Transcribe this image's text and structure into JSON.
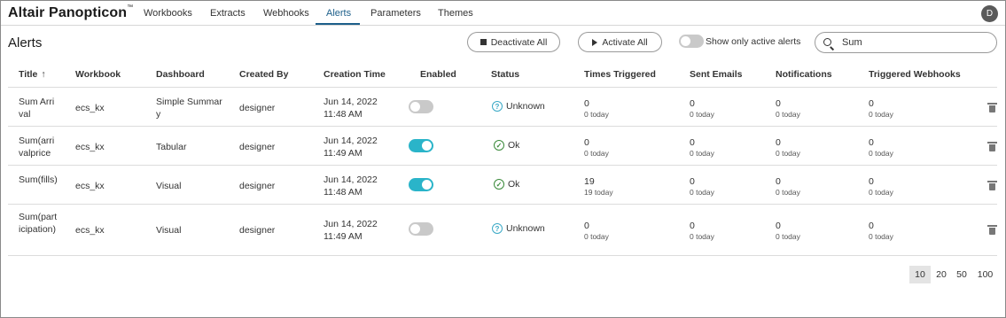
{
  "app": {
    "title": "Altair Panopticon",
    "trademark": "™",
    "user_initial": "D"
  },
  "nav": {
    "tabs": [
      {
        "label": "Workbooks"
      },
      {
        "label": "Extracts"
      },
      {
        "label": "Webhooks"
      },
      {
        "label": "Alerts"
      },
      {
        "label": "Parameters"
      },
      {
        "label": "Themes"
      }
    ],
    "active": "Alerts"
  },
  "page": {
    "title": "Alerts"
  },
  "toolbar": {
    "deactivate_label": "Deactivate All",
    "activate_label": "Activate All",
    "active_filter_label": "Show only active alerts",
    "active_filter_on": false,
    "search_value": "Sum"
  },
  "table": {
    "headers": {
      "title": "Title",
      "sort_indicator": "↑",
      "workbook": "Workbook",
      "dashboard": "Dashboard",
      "created_by": "Created By",
      "creation_time": "Creation Time",
      "enabled": "Enabled",
      "status": "Status",
      "times_triggered": "Times Triggered",
      "sent_emails": "Sent Emails",
      "notifications": "Notifications",
      "triggered_webhooks": "Triggered Webhooks"
    },
    "rows": [
      {
        "title": "Sum Arrival",
        "workbook": "ecs_kx",
        "dashboard": "Simple Summary",
        "created_by": "designer",
        "creation_time": "Jun 14, 2022 11:48 AM",
        "enabled": false,
        "status": "Unknown",
        "status_icon": "question-icon",
        "times_triggered": "0",
        "times_triggered_today": "0 today",
        "sent_emails": "0",
        "sent_emails_today": "0 today",
        "notifications": "0",
        "notifications_today": "0 today",
        "webhooks": "0",
        "webhooks_today": "0 today"
      },
      {
        "title": "Sum(arrivalprice",
        "workbook": "ecs_kx",
        "dashboard": "Tabular",
        "created_by": "designer",
        "creation_time": "Jun 14, 2022 11:49 AM",
        "enabled": true,
        "status": "Ok",
        "status_icon": "check-circle-icon",
        "times_triggered": "0",
        "times_triggered_today": "0 today",
        "sent_emails": "0",
        "sent_emails_today": "0 today",
        "notifications": "0",
        "notifications_today": "0 today",
        "webhooks": "0",
        "webhooks_today": "0 today"
      },
      {
        "title": "Sum(fills)",
        "workbook": "ecs_kx",
        "dashboard": "Visual",
        "created_by": "designer",
        "creation_time": "Jun 14, 2022 11:48 AM",
        "enabled": true,
        "status": "Ok",
        "status_icon": "check-circle-icon",
        "times_triggered": "19",
        "times_triggered_today": "19 today",
        "sent_emails": "0",
        "sent_emails_today": "0 today",
        "notifications": "0",
        "notifications_today": "0 today",
        "webhooks": "0",
        "webhooks_today": "0 today"
      },
      {
        "title": "Sum(participation)",
        "workbook": "ecs_kx",
        "dashboard": "Visual",
        "created_by": "designer",
        "creation_time": "Jun 14, 2022 11:49 AM",
        "enabled": false,
        "status": "Unknown",
        "status_icon": "question-icon",
        "times_triggered": "0",
        "times_triggered_today": "0 today",
        "sent_emails": "0",
        "sent_emails_today": "0 today",
        "notifications": "0",
        "notifications_today": "0 today",
        "webhooks": "0",
        "webhooks_today": "0 today"
      }
    ]
  },
  "pagination": {
    "sizes": [
      "10",
      "20",
      "50",
      "100"
    ],
    "selected": "10"
  },
  "colors": {
    "accent": "#1d5f8a",
    "toggle_on": "#2ab4c9",
    "ok": "#3a8a3a",
    "unknown": "#3aa9c6"
  }
}
